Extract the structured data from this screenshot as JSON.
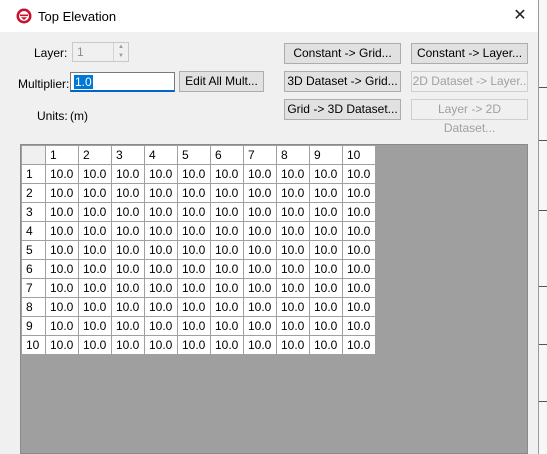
{
  "window": {
    "title": "Top Elevation",
    "close_symbol": "✕"
  },
  "controls": {
    "layer_label": "Layer:",
    "layer_value": "1",
    "multiplier_label": "Multiplier:",
    "multiplier_value": "1.0",
    "units_label": "Units:",
    "units_value": "(m)"
  },
  "buttons": {
    "edit_all_mult": "Edit All Mult...",
    "constant_to_grid": "Constant -> Grid...",
    "constant_to_layer": "Constant -> Layer...",
    "dataset3d_to_grid": "3D Dataset -> Grid...",
    "dataset2d_to_layer": "2D Dataset -> Layer..",
    "grid_to_3d_dataset": "Grid -> 3D Dataset...",
    "layer_to_2d_dataset": "Layer -> 2D Dataset..."
  },
  "icons": {
    "app": "app-logo-icon",
    "close": "close-icon"
  },
  "grid": {
    "columns": [
      "1",
      "2",
      "3",
      "4",
      "5",
      "6",
      "7",
      "8",
      "9",
      "10"
    ],
    "rows": [
      {
        "label": "1",
        "cells": [
          "10.0",
          "10.0",
          "10.0",
          "10.0",
          "10.0",
          "10.0",
          "10.0",
          "10.0",
          "10.0",
          "10.0"
        ]
      },
      {
        "label": "2",
        "cells": [
          "10.0",
          "10.0",
          "10.0",
          "10.0",
          "10.0",
          "10.0",
          "10.0",
          "10.0",
          "10.0",
          "10.0"
        ]
      },
      {
        "label": "3",
        "cells": [
          "10.0",
          "10.0",
          "10.0",
          "10.0",
          "10.0",
          "10.0",
          "10.0",
          "10.0",
          "10.0",
          "10.0"
        ]
      },
      {
        "label": "4",
        "cells": [
          "10.0",
          "10.0",
          "10.0",
          "10.0",
          "10.0",
          "10.0",
          "10.0",
          "10.0",
          "10.0",
          "10.0"
        ]
      },
      {
        "label": "5",
        "cells": [
          "10.0",
          "10.0",
          "10.0",
          "10.0",
          "10.0",
          "10.0",
          "10.0",
          "10.0",
          "10.0",
          "10.0"
        ]
      },
      {
        "label": "6",
        "cells": [
          "10.0",
          "10.0",
          "10.0",
          "10.0",
          "10.0",
          "10.0",
          "10.0",
          "10.0",
          "10.0",
          "10.0"
        ]
      },
      {
        "label": "7",
        "cells": [
          "10.0",
          "10.0",
          "10.0",
          "10.0",
          "10.0",
          "10.0",
          "10.0",
          "10.0",
          "10.0",
          "10.0"
        ]
      },
      {
        "label": "8",
        "cells": [
          "10.0",
          "10.0",
          "10.0",
          "10.0",
          "10.0",
          "10.0",
          "10.0",
          "10.0",
          "10.0",
          "10.0"
        ]
      },
      {
        "label": "9",
        "cells": [
          "10.0",
          "10.0",
          "10.0",
          "10.0",
          "10.0",
          "10.0",
          "10.0",
          "10.0",
          "10.0",
          "10.0"
        ]
      },
      {
        "label": "10",
        "cells": [
          "10.0",
          "10.0",
          "10.0",
          "10.0",
          "10.0",
          "10.0",
          "10.0",
          "10.0",
          "10.0",
          "10.0"
        ]
      }
    ]
  },
  "colors": {
    "accent": "#0078d7",
    "icon_red": "#c8102e",
    "grid_background": "#9f9f9f"
  }
}
